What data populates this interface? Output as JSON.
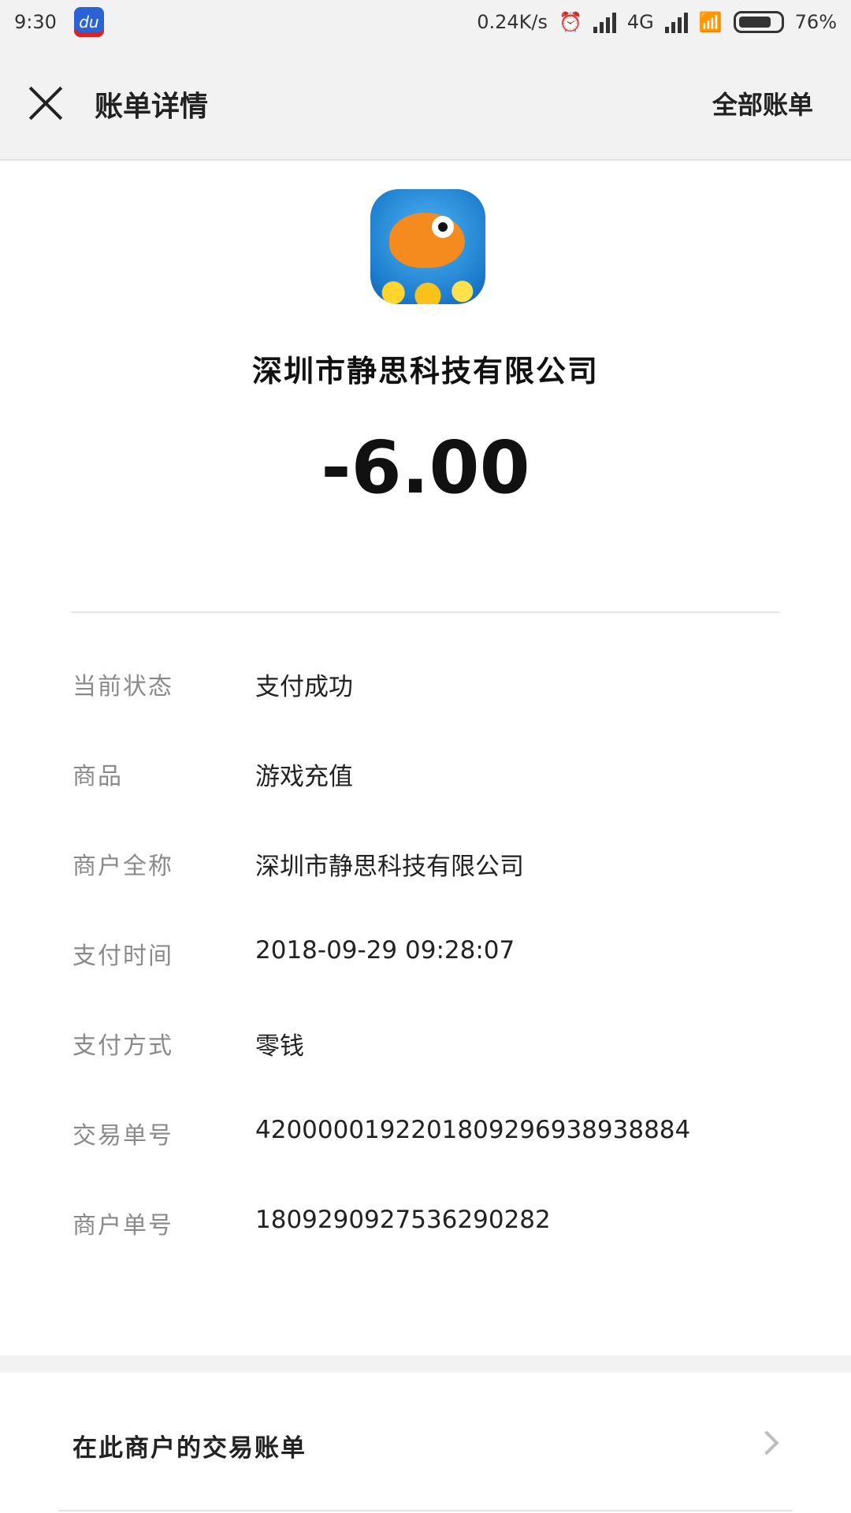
{
  "status_bar": {
    "time": "9:30",
    "app_badge": "du",
    "speed": "0.24K/s",
    "network": "4G",
    "battery": "76%"
  },
  "header": {
    "title": "账单详情",
    "right_link": "全部账单"
  },
  "merchant": {
    "name": "深圳市静思科技有限公司",
    "amount": "-6.00"
  },
  "details": [
    {
      "label": "当前状态",
      "value": "支付成功"
    },
    {
      "label": "商品",
      "value": "游戏充值"
    },
    {
      "label": "商户全称",
      "value": "深圳市静思科技有限公司"
    },
    {
      "label": "支付时间",
      "value": "2018-09-29 09:28:07"
    },
    {
      "label": "支付方式",
      "value": "零钱"
    },
    {
      "label": "交易单号",
      "value": "4200000192201809296938938884"
    },
    {
      "label": "商户单号",
      "value": "1809290927536290282"
    }
  ],
  "footer": {
    "merchant_bills_label": "在此商户的交易账单"
  }
}
